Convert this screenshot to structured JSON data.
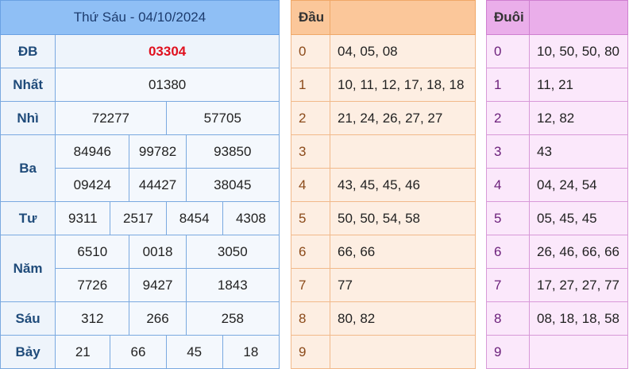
{
  "results": {
    "header": "Thứ Sáu - 04/10/2024",
    "prizes": {
      "db": {
        "label": "ĐB",
        "values": [
          "03304"
        ]
      },
      "nhat": {
        "label": "Nhất",
        "values": [
          "01380"
        ]
      },
      "nhi": {
        "label": "Nhì",
        "values": [
          "72277",
          "57705"
        ]
      },
      "ba": {
        "label": "Ba",
        "values": [
          "84946",
          "99782",
          "93850",
          "09424",
          "44427",
          "38045"
        ]
      },
      "tu": {
        "label": "Tư",
        "values": [
          "9311",
          "2517",
          "8454",
          "4308"
        ]
      },
      "nam": {
        "label": "Năm",
        "values": [
          "6510",
          "0018",
          "3050",
          "7726",
          "9427",
          "1843"
        ]
      },
      "sau": {
        "label": "Sáu",
        "values": [
          "312",
          "266",
          "258"
        ]
      },
      "bay": {
        "label": "Bảy",
        "values": [
          "21",
          "66",
          "45",
          "18"
        ]
      }
    }
  },
  "dau": {
    "header": "Đầu",
    "rows": [
      {
        "idx": "0",
        "values": "04, 05, 08"
      },
      {
        "idx": "1",
        "values": "10, 11, 12, 17, 18, 18"
      },
      {
        "idx": "2",
        "values": "21, 24, 26, 27, 27"
      },
      {
        "idx": "3",
        "values": ""
      },
      {
        "idx": "4",
        "values": "43, 45, 45, 46"
      },
      {
        "idx": "5",
        "values": "50, 50, 54, 58"
      },
      {
        "idx": "6",
        "values": "66, 66"
      },
      {
        "idx": "7",
        "values": "77"
      },
      {
        "idx": "8",
        "values": "80, 82"
      },
      {
        "idx": "9",
        "values": ""
      }
    ]
  },
  "duoi": {
    "header": "Đuôi",
    "rows": [
      {
        "idx": "0",
        "values": "10, 50, 50, 80"
      },
      {
        "idx": "1",
        "values": "11, 21"
      },
      {
        "idx": "2",
        "values": "12, 82"
      },
      {
        "idx": "3",
        "values": "43"
      },
      {
        "idx": "4",
        "values": "04, 24, 54"
      },
      {
        "idx": "5",
        "values": "05, 45, 45"
      },
      {
        "idx": "6",
        "values": "26, 46, 66, 66"
      },
      {
        "idx": "7",
        "values": "17, 27, 27, 77"
      },
      {
        "idx": "8",
        "values": "08, 18, 18, 58"
      },
      {
        "idx": "9",
        "values": ""
      }
    ]
  },
  "colors": {
    "special_prize": "#e0101e",
    "prize_label": "#1f4b7a",
    "results_header": "#8fbff5",
    "dau_header": "#fbc79a",
    "duoi_header": "#eaaeea"
  }
}
